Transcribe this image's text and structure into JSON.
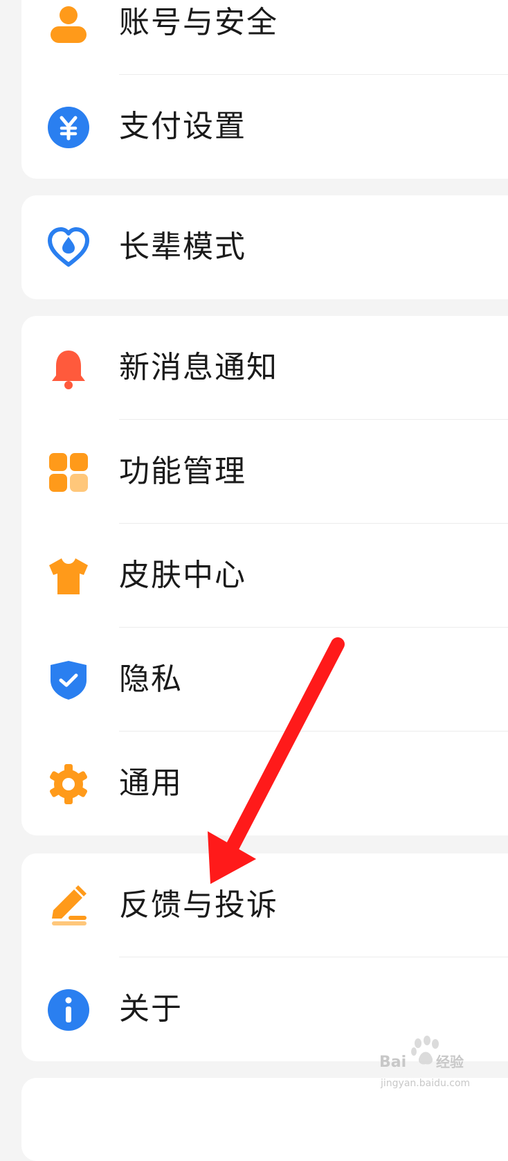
{
  "settings": {
    "groups": [
      {
        "items": [
          {
            "label": "账号与安全",
            "icon": "person-icon"
          },
          {
            "label": "支付设置",
            "icon": "yuan-icon"
          }
        ]
      },
      {
        "items": [
          {
            "label": "长辈模式",
            "icon": "heart-icon"
          }
        ]
      },
      {
        "items": [
          {
            "label": "新消息通知",
            "icon": "bell-icon"
          },
          {
            "label": "功能管理",
            "icon": "grid-icon"
          },
          {
            "label": "皮肤中心",
            "icon": "tshirt-icon"
          },
          {
            "label": "隐私",
            "icon": "shield-check-icon"
          },
          {
            "label": "通用",
            "icon": "gear-icon"
          }
        ]
      },
      {
        "items": [
          {
            "label": "反馈与投诉",
            "icon": "pencil-icon"
          },
          {
            "label": "关于",
            "icon": "info-icon"
          }
        ]
      }
    ]
  },
  "watermark": {
    "brand": "Bai du 经验",
    "url": "jingyan.baidu.com"
  },
  "colors": {
    "orange": "#ff9a1a",
    "blue": "#2a7ff0",
    "red": "#ff5a3c",
    "arrow": "#ff1a1a",
    "background": "#f4f4f4"
  }
}
